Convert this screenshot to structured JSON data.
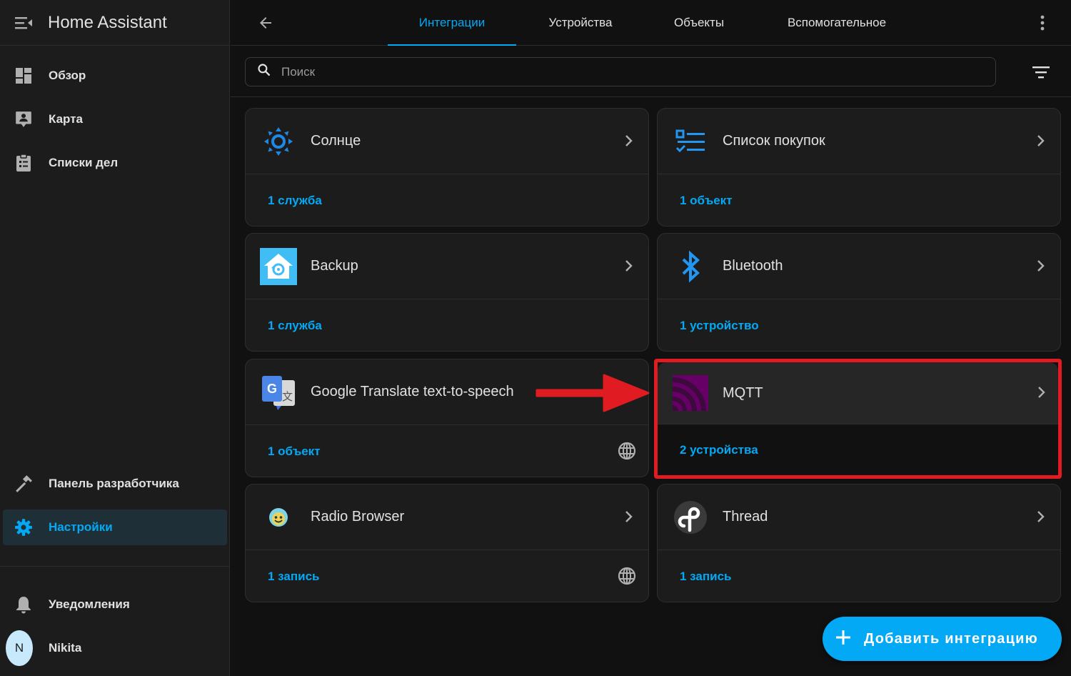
{
  "app": {
    "title": "Home Assistant"
  },
  "sidebar": {
    "items": [
      {
        "label": "Обзор",
        "icon": "dashboard-icon"
      },
      {
        "label": "Карта",
        "icon": "map-account-icon"
      },
      {
        "label": "Списки дел",
        "icon": "clipboard-list-icon"
      }
    ],
    "developer": {
      "label": "Панель разработчика",
      "icon": "hammer-icon"
    },
    "settings": {
      "label": "Настройки",
      "icon": "cog-icon"
    },
    "notifications": {
      "label": "Уведомления",
      "icon": "bell-icon"
    },
    "user": {
      "name": "Nikita",
      "initial": "N"
    }
  },
  "tabs": [
    {
      "label": "Интеграции",
      "active": true
    },
    {
      "label": "Устройства",
      "active": false
    },
    {
      "label": "Объекты",
      "active": false
    },
    {
      "label": "Вспомогательное",
      "active": false
    }
  ],
  "search": {
    "placeholder": "Поиск",
    "value": ""
  },
  "integrations": [
    {
      "title": "Солнце",
      "link": "1 служба",
      "icon": "sun-icon",
      "cloud": false
    },
    {
      "title": "Список покупок",
      "link": "1 объект",
      "icon": "shopping-list-icon",
      "cloud": false
    },
    {
      "title": "Backup",
      "link": "1 служба",
      "icon": "backup-icon",
      "cloud": false
    },
    {
      "title": "Bluetooth",
      "link": "1 устройство",
      "icon": "bluetooth-icon",
      "cloud": false
    },
    {
      "title": "Google Translate text-to-speech",
      "link": "1 объект",
      "icon": "google-translate-icon",
      "cloud": true
    },
    {
      "title": "MQTT",
      "link": "2 устройства",
      "icon": "mqtt-icon",
      "cloud": false,
      "highlighted": true
    },
    {
      "title": "Radio Browser",
      "link": "1 запись",
      "icon": "radio-browser-icon",
      "cloud": true
    },
    {
      "title": "Thread",
      "link": "1 запись",
      "icon": "thread-icon",
      "cloud": false
    }
  ],
  "fab": {
    "label": "Добавить интеграцию",
    "icon": "plus-icon"
  },
  "colors": {
    "accent": "#03a9f4",
    "highlight": "#e11b22",
    "background": "#111111",
    "card": "#1c1c1c",
    "mqtt": "#660066"
  }
}
